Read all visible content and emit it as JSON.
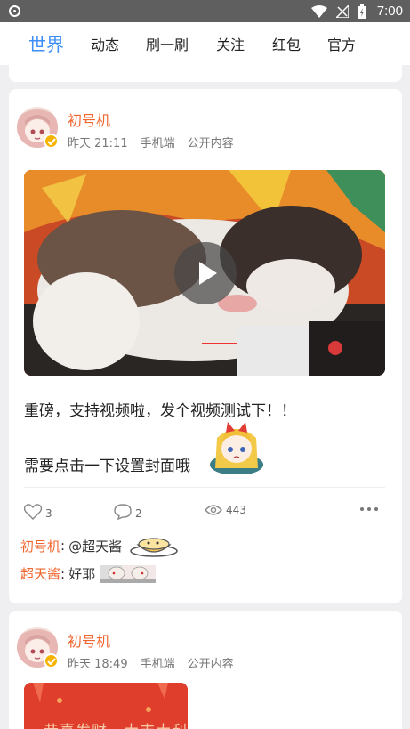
{
  "status_bar": {
    "time": "7:00"
  },
  "tabs": [
    {
      "label": "世界",
      "active": true
    },
    {
      "label": "动态",
      "active": false
    },
    {
      "label": "刷一刷",
      "active": false
    },
    {
      "label": "关注",
      "active": false
    },
    {
      "label": "红包",
      "active": false
    },
    {
      "label": "官方",
      "active": false
    }
  ],
  "posts": [
    {
      "author": "初号机",
      "time": "昨天 21:11",
      "device": "手机端",
      "visibility": "公开内容",
      "media": "video",
      "text_lines": [
        "重磅，支持视频啦，发个视频测试下！！",
        "需要点击一下设置封面哦"
      ],
      "likes": "3",
      "comments_count": "2",
      "views": "443",
      "comments": [
        {
          "name": "初号机",
          "sep": ":",
          "text": "@超天酱"
        },
        {
          "name": "超天酱",
          "sep": ":",
          "text": "好耶"
        }
      ]
    },
    {
      "author": "初号机",
      "time": "昨天 18:49",
      "device": "手机端",
      "visibility": "公开内容",
      "media": "image",
      "image_text": "恭喜发财，大吉大利"
    }
  ],
  "colors": {
    "accent": "#3e8ef7",
    "username": "#f0662e",
    "badge": "#f6b300",
    "status_bar": "#5f5f5f"
  },
  "icons": {
    "like": "heart-icon",
    "comment": "comment-bubble-icon",
    "views": "eye-icon",
    "more": "more-dots-icon",
    "play": "play-icon",
    "verified": "verified-badge-icon"
  }
}
